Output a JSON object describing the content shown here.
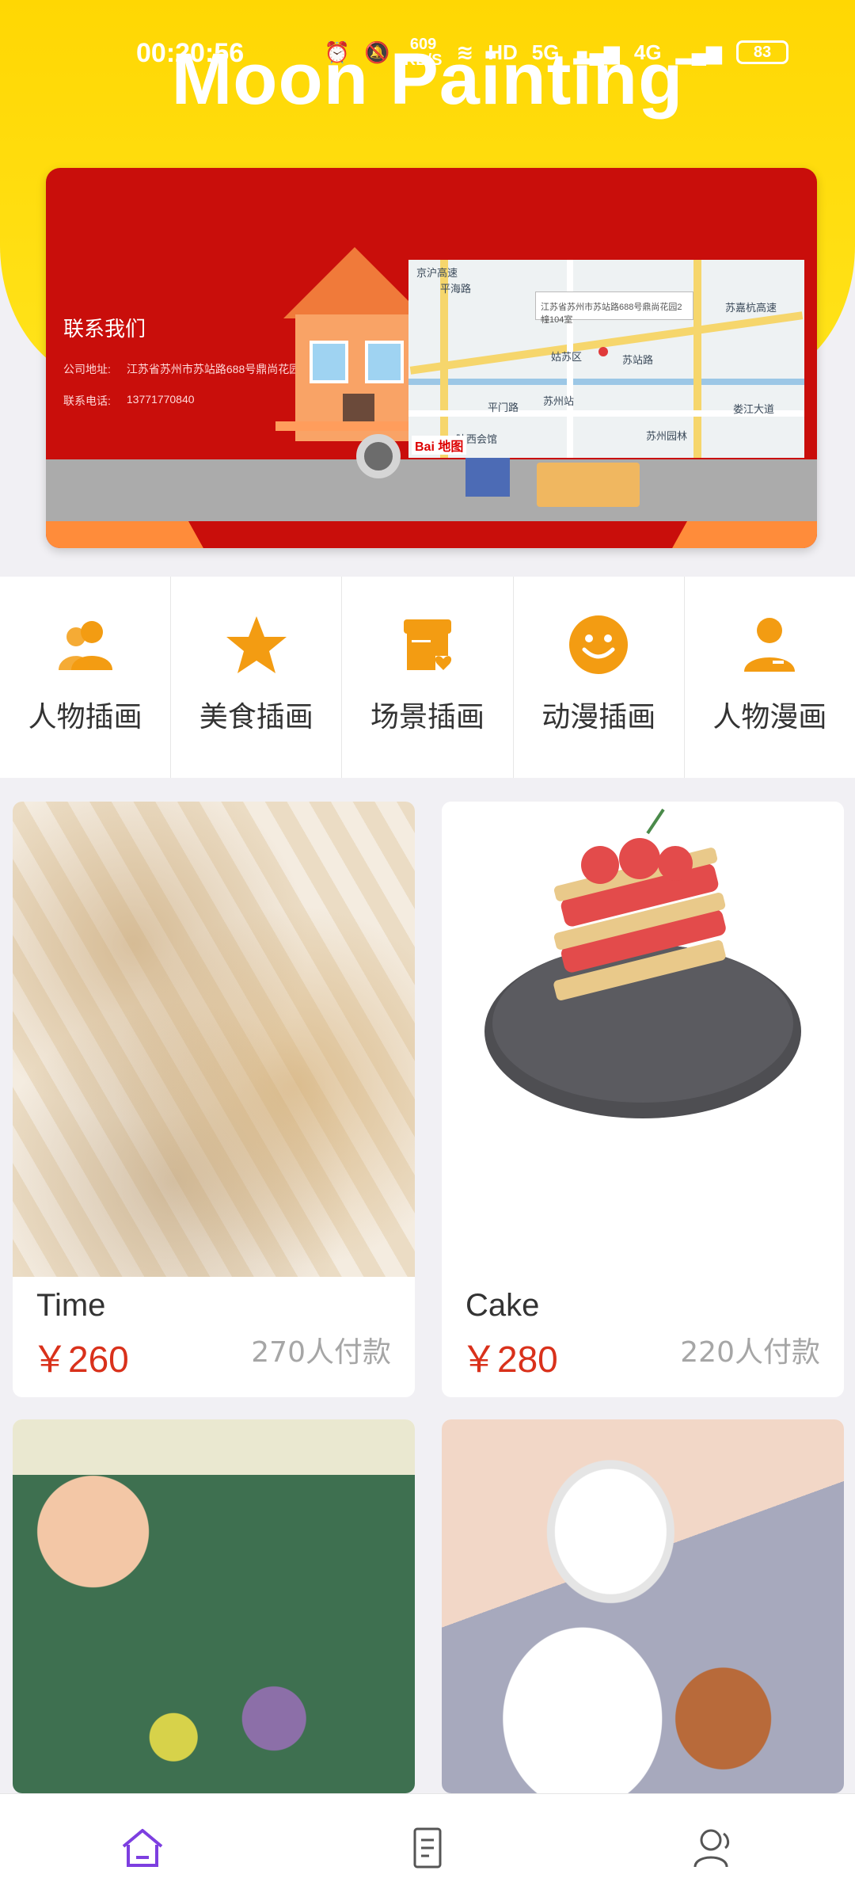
{
  "status_bar": {
    "time": "00:20:56",
    "network_speed": "609",
    "network_unit": "KB/S",
    "hd_label": "HD",
    "signal_1": "5G",
    "signal_2": "4G",
    "battery": "83"
  },
  "header": {
    "title": "Moon Painting"
  },
  "banner": {
    "title": "联系我们",
    "address_label": "公司地址:",
    "address_value": "江苏省苏州市苏站路688号鼎尚花园2幢104室",
    "phone_label": "联系电话:",
    "phone_value": "13771770840",
    "map_bubble": "江苏省苏州市苏站路688号鼎尚花园2幢104室",
    "map_logo": "Bai 地图",
    "map_labels": [
      "京沪高速",
      "平海路",
      "姑苏区",
      "苏站路",
      "苏州站",
      "平门路",
      "苏州园林",
      "娄江大道",
      "苏嘉杭高速",
      "陕西会馆"
    ]
  },
  "categories": [
    {
      "label": "人物插画",
      "icon": "people-icon"
    },
    {
      "label": "美食插画",
      "icon": "star-icon"
    },
    {
      "label": "场景插画",
      "icon": "store-icon"
    },
    {
      "label": "动漫插画",
      "icon": "smile-icon"
    },
    {
      "label": "人物漫画",
      "icon": "person-icon"
    }
  ],
  "products": [
    {
      "name": "Time",
      "price": "￥260",
      "paid": "270人付款"
    },
    {
      "name": "Cake",
      "price": "￥280",
      "paid": "220人付款"
    },
    {
      "name": "",
      "price": "",
      "paid": ""
    },
    {
      "name": "",
      "price": "",
      "paid": ""
    }
  ],
  "tabbar": {
    "items": [
      {
        "icon": "home-icon",
        "active": true
      },
      {
        "icon": "document-icon",
        "active": false
      },
      {
        "icon": "user-icon",
        "active": false
      }
    ]
  },
  "colors": {
    "header_yellow": "#ffd703",
    "accent_orange": "#f39c12",
    "price_red": "#d9311b",
    "active_tab": "#7d3fe0"
  }
}
